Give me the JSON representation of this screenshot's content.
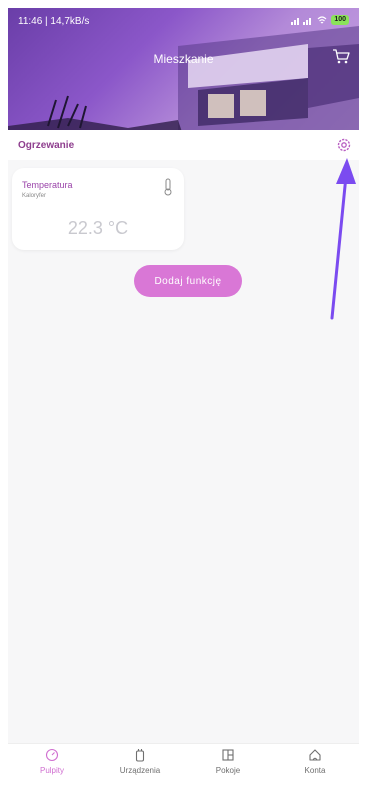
{
  "status_bar": {
    "time": "11:46 | 14,7kB/s",
    "battery": "100"
  },
  "header": {
    "title": "Mieszkanie"
  },
  "section": {
    "title": "Ogrzewanie"
  },
  "tile": {
    "title": "Temperatura",
    "subtitle": "Kaloryfer",
    "value": "22.3 °C"
  },
  "add_button": {
    "label": "Dodaj funkcję"
  },
  "bottom_nav": {
    "items": [
      {
        "label": "Pulpity",
        "icon": "dashboard-icon",
        "active": true
      },
      {
        "label": "Urządzenia",
        "icon": "device-icon",
        "active": false
      },
      {
        "label": "Pokoje",
        "icon": "room-icon",
        "active": false
      },
      {
        "label": "Konta",
        "icon": "account-icon",
        "active": false
      }
    ]
  },
  "colors": {
    "accent": "#d977d6",
    "section_title": "#8e3e8e",
    "header_gradient": "#8b57c9",
    "arrow": "#7b4bf0"
  }
}
